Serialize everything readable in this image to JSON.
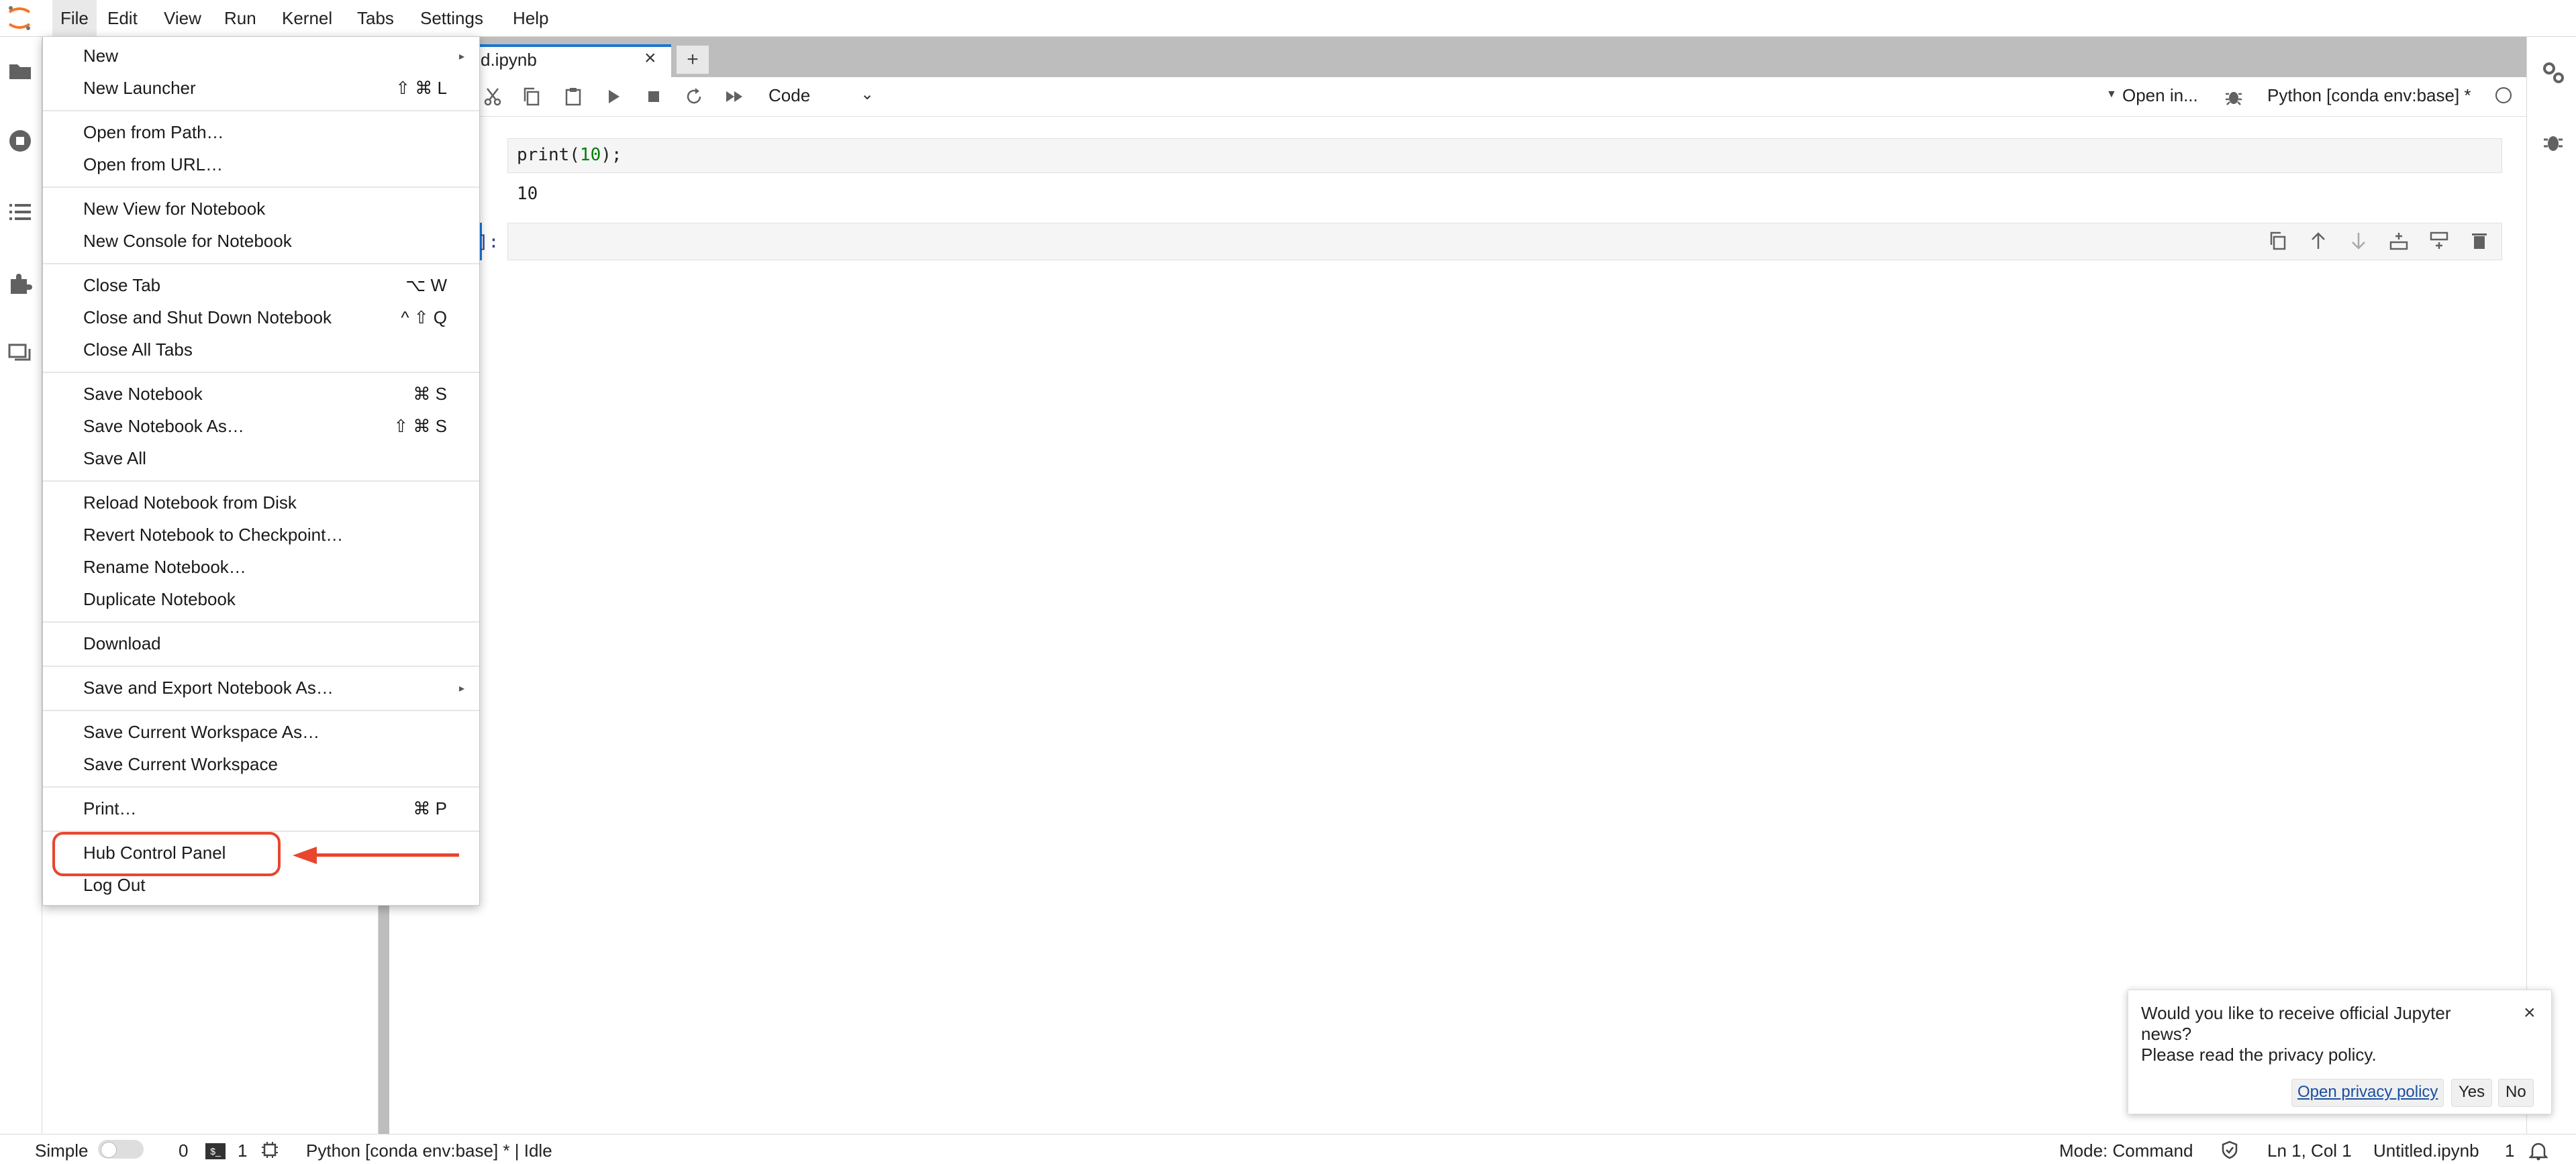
{
  "menubar": {
    "items": [
      "File",
      "Edit",
      "View",
      "Run",
      "Kernel",
      "Tabs",
      "Settings",
      "Help"
    ]
  },
  "tab": {
    "label": "d.ipynb",
    "close": "×",
    "add": "+"
  },
  "toolbar": {
    "cell_type": "Code",
    "open_in": "Open in...",
    "kernel": "Python [conda env:base] *"
  },
  "cells": [
    {
      "prompt": "]:",
      "code_prefix": "print(",
      "code_num": "10",
      "code_suffix": ");",
      "output": "10"
    },
    {
      "prompt": "]:"
    }
  ],
  "file_menu": {
    "items": [
      {
        "label": "New",
        "shortcut": "",
        "submenu": true
      },
      {
        "label": "New Launcher",
        "shortcut": "⇧ ⌘ L"
      },
      {
        "label": "Open from Path…",
        "shortcut": ""
      },
      {
        "label": "Open from URL…",
        "shortcut": ""
      },
      {
        "label": "New View for Notebook",
        "shortcut": ""
      },
      {
        "label": "New Console for Notebook",
        "shortcut": ""
      },
      {
        "label": "Close Tab",
        "shortcut": "⌥ W"
      },
      {
        "label": "Close and Shut Down Notebook",
        "shortcut": "^ ⇧ Q"
      },
      {
        "label": "Close All Tabs",
        "shortcut": ""
      },
      {
        "label": "Save Notebook",
        "shortcut": "⌘ S"
      },
      {
        "label": "Save Notebook As…",
        "shortcut": "⇧ ⌘ S"
      },
      {
        "label": "Save All",
        "shortcut": ""
      },
      {
        "label": "Reload Notebook from Disk",
        "shortcut": ""
      },
      {
        "label": "Revert Notebook to Checkpoint…",
        "shortcut": ""
      },
      {
        "label": "Rename Notebook…",
        "shortcut": ""
      },
      {
        "label": "Duplicate Notebook",
        "shortcut": ""
      },
      {
        "label": "Download",
        "shortcut": ""
      },
      {
        "label": "Save and Export Notebook As…",
        "shortcut": "",
        "submenu": true
      },
      {
        "label": "Save Current Workspace As…",
        "shortcut": ""
      },
      {
        "label": "Save Current Workspace",
        "shortcut": ""
      },
      {
        "label": "Print…",
        "shortcut": "⌘ P"
      },
      {
        "label": "Hub Control Panel",
        "shortcut": ""
      },
      {
        "label": "Log Out",
        "shortcut": ""
      }
    ]
  },
  "notification": {
    "message": "Would you like to receive official Jupyter news?\nPlease read the privacy policy.",
    "link": "Open privacy policy",
    "yes": "Yes",
    "no": "No",
    "close": "×"
  },
  "statusbar": {
    "mode_toggle": "Simple",
    "terminals": "0",
    "kernels": "1",
    "kernel_status": "Python [conda env:base] * | Idle",
    "mode": "Mode: Command",
    "cursor": "Ln 1, Col 1",
    "filename": "Untitled.ipynb",
    "notifications": "1"
  },
  "colors": {
    "accent": "#1976d2",
    "highlight": "#e8462e",
    "logo": "#f37726"
  }
}
